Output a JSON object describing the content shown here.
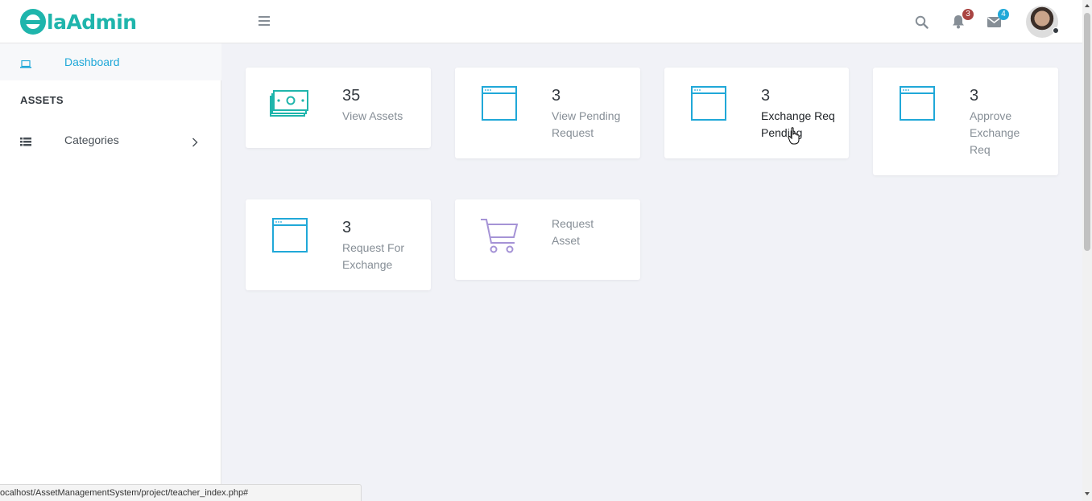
{
  "brand": {
    "logo_text": "laAdmin",
    "accent": "#1fb5ac"
  },
  "header": {
    "notifications": {
      "icon": "bell-icon",
      "count": "3",
      "color": "#c0392b"
    },
    "messages": {
      "icon": "envelope-icon",
      "count": "4",
      "color": "#20a8d8"
    }
  },
  "sidebar": {
    "items": [
      {
        "label": "Dashboard",
        "icon": "laptop-icon"
      },
      {
        "label": "Categories",
        "icon": "table-icon"
      }
    ],
    "section_title": "ASSETS"
  },
  "cards": [
    {
      "count": "35",
      "label": "View Assets",
      "icon": "money-icon"
    },
    {
      "count": "3",
      "label": "View Pending Request",
      "icon": "browser-window-icon"
    },
    {
      "count": "3",
      "label": "Exchange Req Pending",
      "icon": "browser-window-icon"
    },
    {
      "count": "3",
      "label": "Approve Exchange Req",
      "icon": "browser-window-icon"
    },
    {
      "count": "3",
      "label": "Request For Exchange",
      "icon": "browser-window-icon"
    },
    {
      "count": "",
      "label": "Request Asset",
      "icon": "cart-icon"
    }
  ],
  "status_bar": {
    "url": "ocalhost/AssetManagementSystem/project/teacher_index.php#"
  }
}
